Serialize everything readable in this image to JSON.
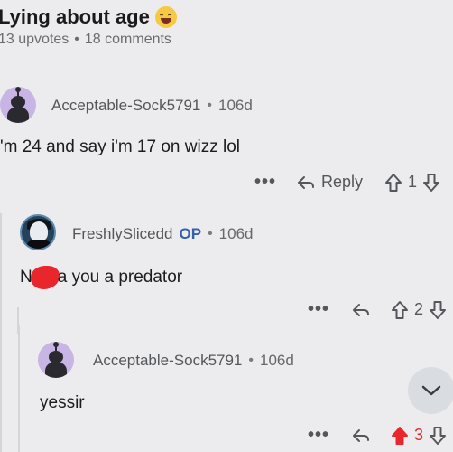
{
  "post": {
    "title": "Lying about age",
    "emoji": "laughing-tears-emoji",
    "upvotes": "13 upvotes",
    "separator": "•",
    "comments": "18 comments"
  },
  "comments": [
    {
      "username": "Acceptable-Sock5791",
      "age": "106d",
      "text": "'m 24 and say i'm 17 on wizz lol",
      "more": "•••",
      "reply_label": "Reply",
      "score": "1"
    },
    {
      "username": "FreshlySlicedd",
      "badge": "OP",
      "age": "106d",
      "text_prefix": "N",
      "text_suffix": "a you a predator",
      "more": "•••",
      "score": "2"
    },
    {
      "username": "Acceptable-Sock5791",
      "age": "106d",
      "text": "yessir",
      "more": "•••",
      "score": "3"
    }
  ],
  "colors": {
    "background": "#ececef",
    "op_badge": "#3560a8",
    "upvoted": "#e8262c",
    "avatar_purple": "#c9b4e6"
  }
}
